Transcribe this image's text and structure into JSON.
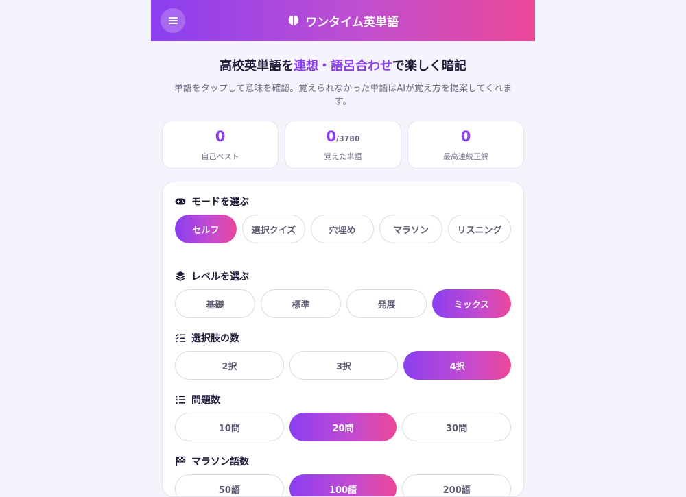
{
  "header": {
    "title": "ワンタイム英単語",
    "menu_icon": "hamburger-icon",
    "brand_icon": "brain-icon"
  },
  "hero": {
    "title_before": "高校英単語を",
    "title_highlight": "連想・語呂合わせ",
    "title_after": "で楽しく暗記",
    "subtitle": "単語をタップして意味を確認。覚えられなかった単語はAIが覚え方を提案してくれます。"
  },
  "stats": [
    {
      "value": "0",
      "suffix": "",
      "label": "自己ベスト"
    },
    {
      "value": "0",
      "suffix": "/3780",
      "label": "覚えた単語"
    },
    {
      "value": "0",
      "suffix": "",
      "label": "最高連続正解"
    }
  ],
  "sections": {
    "mode": {
      "title": "モードを選ぶ",
      "icon": "gamepad-icon",
      "options": [
        "セルフ",
        "選択クイズ",
        "穴埋め",
        "マラソン",
        "リスニング"
      ],
      "selected": "セルフ"
    },
    "level": {
      "title": "レベルを選ぶ",
      "icon": "layers-icon",
      "options": [
        "基礎",
        "標準",
        "発展",
        "ミックス"
      ],
      "selected": "ミックス"
    },
    "choices": {
      "title": "選択肢の数",
      "icon": "checklist-icon",
      "options": [
        "2択",
        "3択",
        "4択"
      ],
      "selected": "4択"
    },
    "questions": {
      "title": "問題数",
      "icon": "numbered-list-icon",
      "options": [
        "10問",
        "20問",
        "30問"
      ],
      "selected": "20問"
    },
    "marathon": {
      "title": "マラソン語数",
      "icon": "flag-icon",
      "options": [
        "50語",
        "100語",
        "200語"
      ],
      "selected": "100語"
    }
  },
  "colors": {
    "accent": "#8b3ff0",
    "accent_end": "#ec4899",
    "background": "#f5f3fc"
  }
}
